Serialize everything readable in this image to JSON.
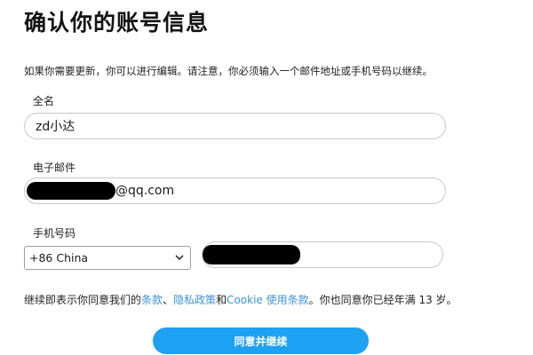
{
  "header": {
    "title": "确认你的账号信息"
  },
  "description": "如果你需要更新，你可以进行编辑。请注意，你必须输入一个邮件地址或手机号码以继续。",
  "form": {
    "name": {
      "label": "全名",
      "value": "zd小达"
    },
    "email": {
      "label": "电子邮件",
      "value_suffix": "@qq.com"
    },
    "phone": {
      "label": "手机号码",
      "country": "+86 China"
    }
  },
  "terms": {
    "prefix": "继续即表示你同意我们的",
    "link_terms": "条款",
    "sep": "、",
    "link_privacy": "隐私政策",
    "and": "和",
    "link_cookie": "Cookie 使用条款",
    "suffix": "。你也同意你已经年满 13 岁。"
  },
  "submit": {
    "label": "同意并继续"
  },
  "icons": {
    "chevron": "chevron-down-icon"
  },
  "colors": {
    "accent": "#1da1f2",
    "link": "#3b94d9"
  }
}
